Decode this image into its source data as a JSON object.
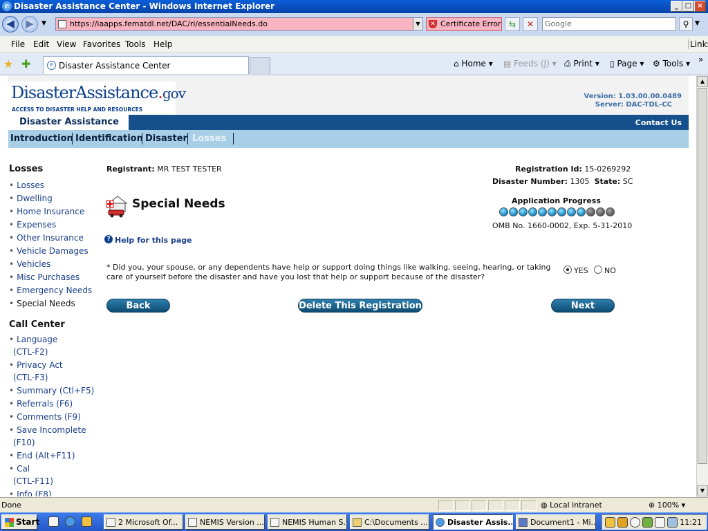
{
  "window": {
    "title": "Disaster Assistance Center - Windows Internet Explorer"
  },
  "address": {
    "url": "https://iaapps.fematdl.net/DAC/ri/essentialNeeds.do",
    "cert_error": "Certificate Error",
    "search_placeholder": "Google"
  },
  "menu": {
    "file": "File",
    "edit": "Edit",
    "view": "View",
    "favorites": "Favorites",
    "tools": "Tools",
    "help": "Help",
    "links": "Links"
  },
  "tabs": {
    "active": "Disaster Assistance Center",
    "home": "Home",
    "feeds": "Feeds (J)",
    "print": "Print",
    "page": "Page",
    "tools": "Tools"
  },
  "site": {
    "logo_main": "DisasterAssistance",
    "logo_dot": ".",
    "logo_gov": "gov",
    "logo_tagline": "ACCESS TO DISASTER HELP AND RESOURCES",
    "version": "Version: 1.03.00.00.0489",
    "server": "Server: DAC-TDL-CC",
    "app_tab": "Disaster Assistance",
    "contact": "Contact Us"
  },
  "steps": [
    {
      "label": "Introduction"
    },
    {
      "label": "Identification"
    },
    {
      "label": "Disaster"
    },
    {
      "label": "Losses"
    }
  ],
  "leftnav": {
    "losses_heading": "Losses",
    "losses_items": [
      "Losses",
      "Dwelling",
      "Home Insurance",
      "Expenses",
      "Other Insurance",
      "Vehicle Damages",
      "Vehicles",
      "Misc Purchases",
      "Emergency Needs",
      "Special Needs"
    ],
    "call_heading": "Call Center",
    "call_items": [
      {
        "label": "Language",
        "sub": "(CTL-F2)"
      },
      {
        "label": "Privacy Act",
        "sub": "(CTL-F3)"
      },
      {
        "label": "Summary (Ctl+F5)",
        "sub": ""
      },
      {
        "label": "Referrals (F6)",
        "sub": ""
      },
      {
        "label": "Comments (F9)",
        "sub": ""
      },
      {
        "label": "Save Incomplete",
        "sub": "(F10)"
      },
      {
        "label": "End (Alt+F11)",
        "sub": ""
      },
      {
        "label": "Cal",
        "sub": "(CTL-F11)"
      },
      {
        "label": "Info (F8)",
        "sub": ""
      }
    ]
  },
  "main": {
    "registrant_label": "Registrant:",
    "registrant_value": "MR TEST TESTER",
    "reg_id_label": "Registration Id:",
    "reg_id_value": "15-0269292",
    "disaster_label": "Disaster Number:",
    "disaster_value": "1305",
    "state_label": "State:",
    "state_value": "SC",
    "page_title": "Special Needs",
    "progress_label": "Application Progress",
    "progress": {
      "completed": 9,
      "total": 12
    },
    "omb": "OMB No. 1660-0002, Exp. 5-31-2010",
    "help_link": "Help for this page",
    "question": "* Did you, your spouse, or any dependents have help or support doing things like walking, seeing, hearing, or taking care of yourself before the disaster and have you lost that help or support because of the disaster?",
    "yes_label": "YES",
    "no_label": "NO",
    "selected": "YES",
    "back": "Back",
    "delete": "Delete This Registration",
    "next": "Next"
  },
  "status": {
    "text": "Done",
    "zone": "Local intranet",
    "zoom": "100%"
  },
  "taskbar": {
    "start": "Start",
    "items": [
      "2 Microsoft Of...",
      "NEMIS Version ...",
      "NEMIS Human S...",
      "C:\\Documents ...",
      "Disaster Assis...",
      "Document1 - Mi..."
    ],
    "clock": "11:21"
  }
}
